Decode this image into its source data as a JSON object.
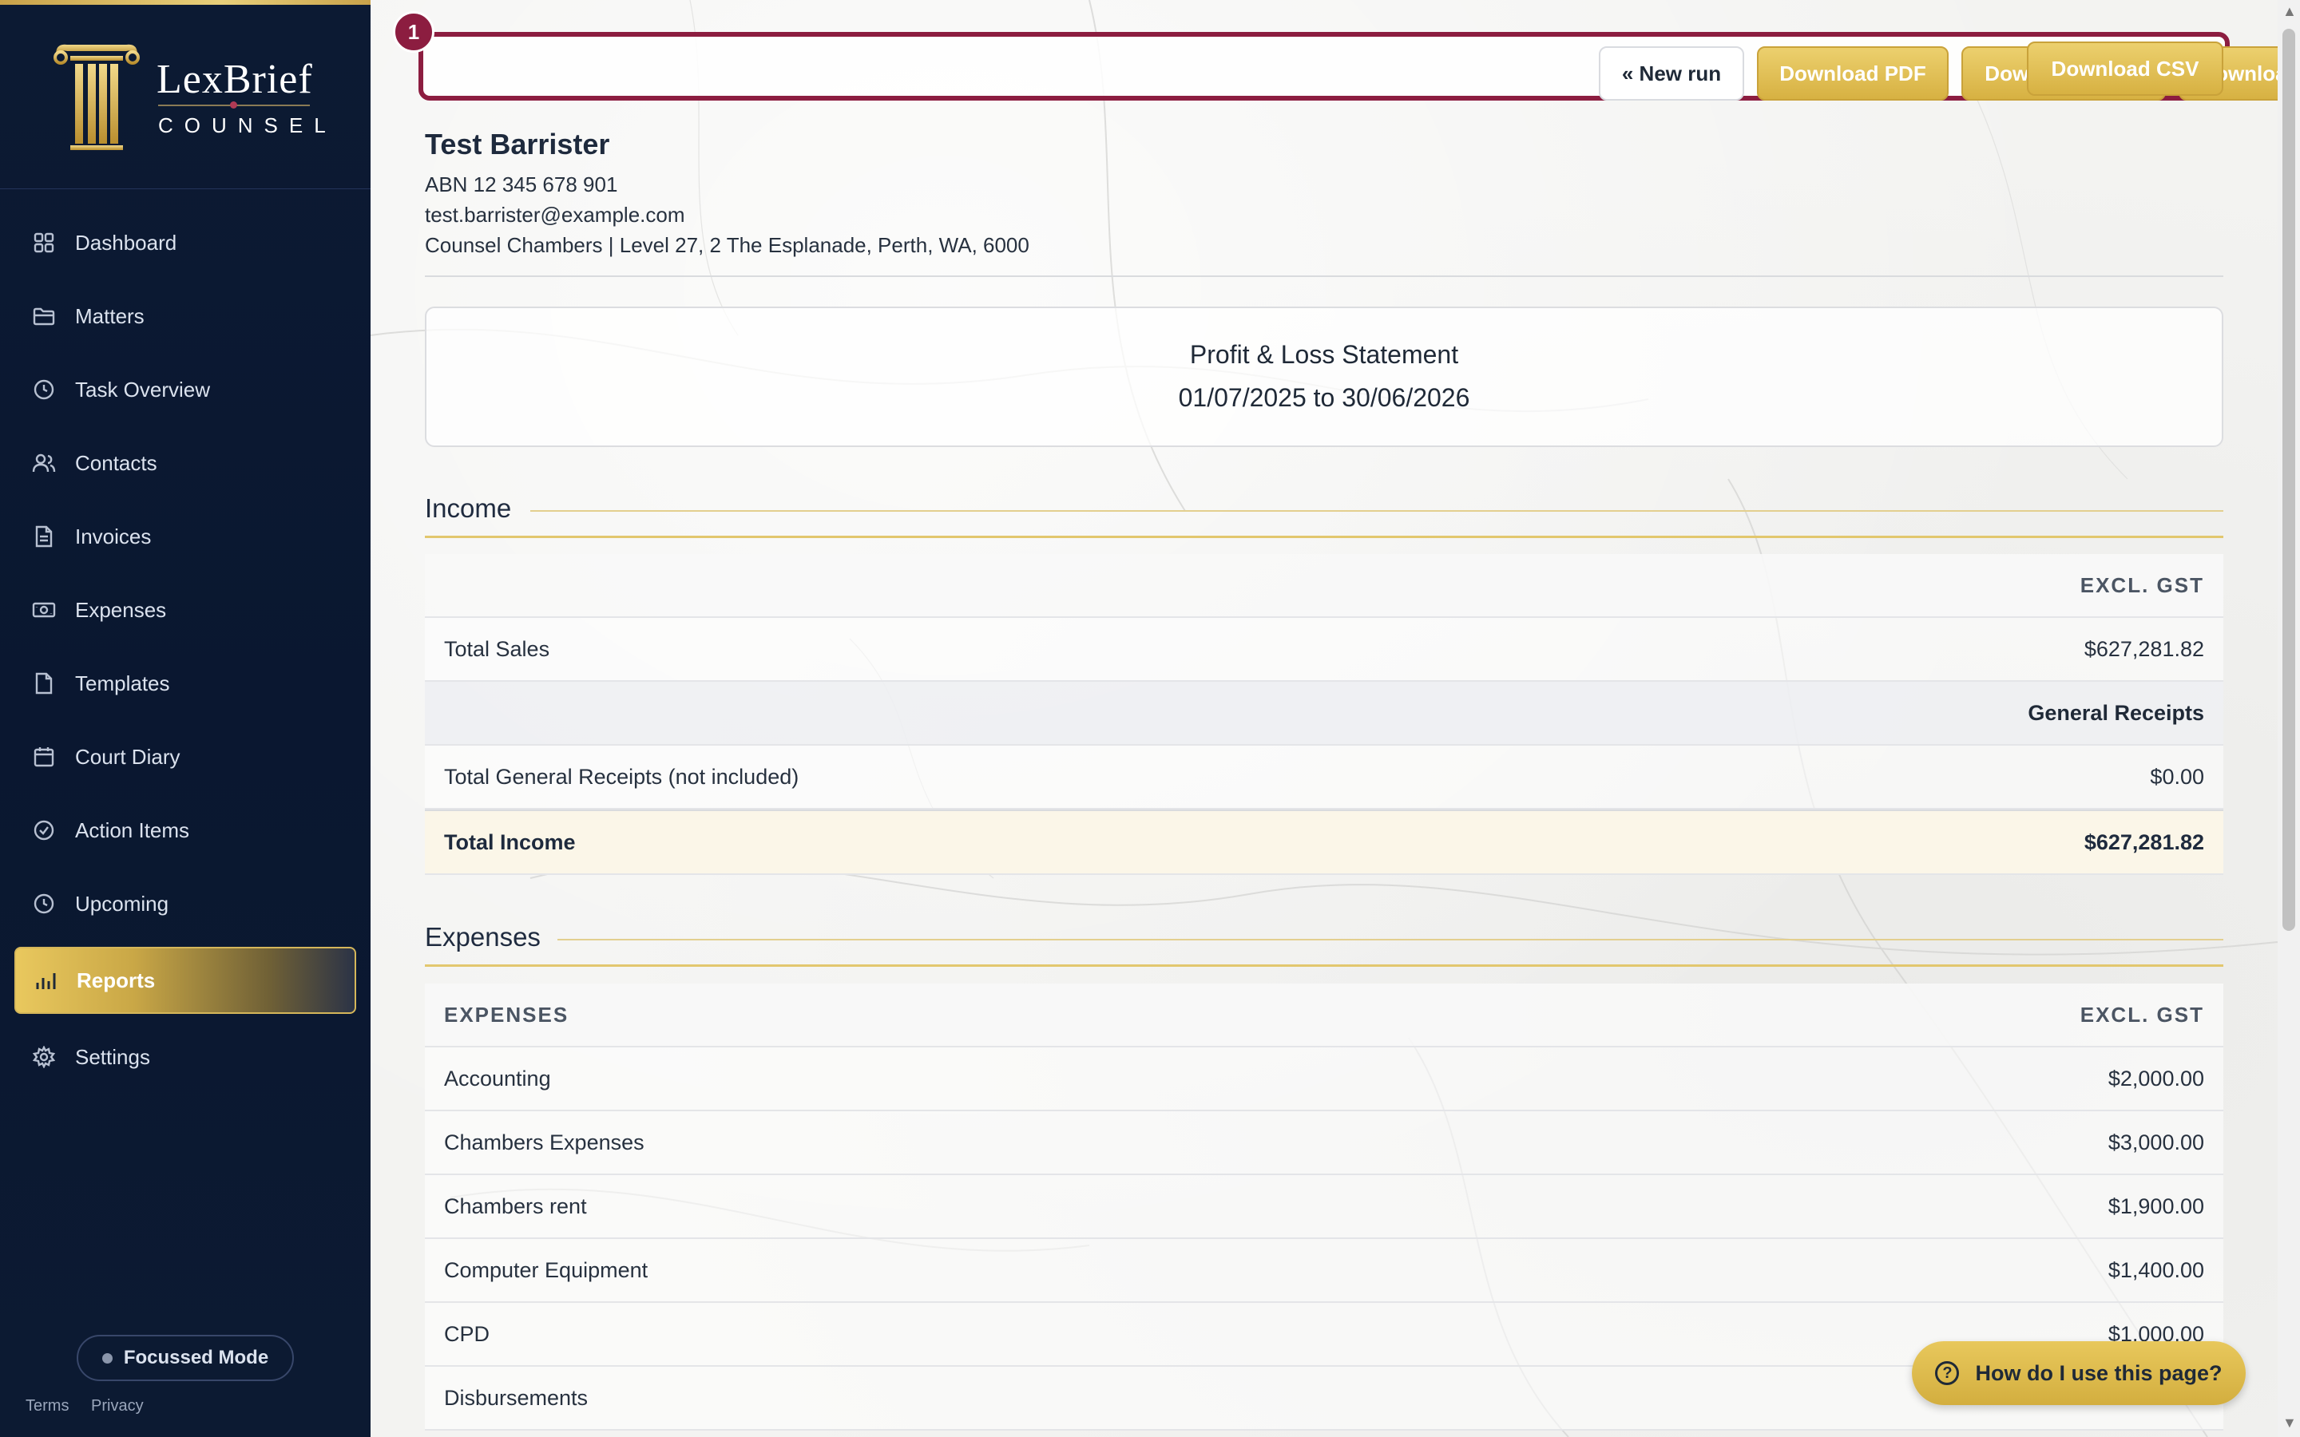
{
  "brand": {
    "name": "LexBrief",
    "tagline": "COUNSEL"
  },
  "colors": {
    "navy": "#0c1a33",
    "gold": "#d7b142",
    "maroon": "#8c1d40"
  },
  "sidebar": {
    "items": [
      {
        "label": "Dashboard",
        "icon": "grid-icon"
      },
      {
        "label": "Matters",
        "icon": "folder-icon"
      },
      {
        "label": "Task Overview",
        "icon": "clock-icon"
      },
      {
        "label": "Contacts",
        "icon": "users-icon"
      },
      {
        "label": "Invoices",
        "icon": "document-icon"
      },
      {
        "label": "Expenses",
        "icon": "banknote-icon"
      },
      {
        "label": "Templates",
        "icon": "file-icon"
      },
      {
        "label": "Court Diary",
        "icon": "calendar-icon"
      },
      {
        "label": "Action Items",
        "icon": "check-circle-icon"
      },
      {
        "label": "Upcoming",
        "icon": "clock-icon"
      },
      {
        "label": "Reports",
        "icon": "bar-chart-icon",
        "active": true
      },
      {
        "label": "Settings",
        "icon": "gear-icon"
      }
    ],
    "focus_mode": "Focussed Mode",
    "terms": "Terms",
    "privacy": "Privacy"
  },
  "toolbar": {
    "step": "1",
    "new_run": "« New run",
    "pdf": "Download PDF",
    "word": "Download Word",
    "excel": "Download Excel",
    "csv": "Download CSV"
  },
  "firm": {
    "name": "Test Barrister",
    "abn": "ABN 12 345 678 901",
    "email": "test.barrister@example.com",
    "address": "Counsel Chambers | Level 27, 2 The Esplanade, Perth, WA, 6000"
  },
  "report": {
    "title": "Profit & Loss Statement",
    "period": "01/07/2025 to 30/06/2026"
  },
  "income": {
    "heading": "Income",
    "col_header": "EXCL. GST",
    "total_sales_label": "Total Sales",
    "total_sales_value": "$627,281.82",
    "general_receipts_label": "General Receipts",
    "general_receipts_total_label": "Total General Receipts (not included)",
    "general_receipts_total_value": "$0.00",
    "total_income_label": "Total Income",
    "total_income_value": "$627,281.82"
  },
  "expenses": {
    "heading": "Expenses",
    "col_left": "EXPENSES",
    "col_right": "EXCL. GST",
    "rows": [
      {
        "label": "Accounting",
        "value": "$2,000.00"
      },
      {
        "label": "Chambers Expenses",
        "value": "$3,000.00"
      },
      {
        "label": "Chambers rent",
        "value": "$1,900.00"
      },
      {
        "label": "Computer Equipment",
        "value": "$1,400.00"
      },
      {
        "label": "CPD",
        "value": "$1,000.00"
      },
      {
        "label": "Disbursements",
        "value": ""
      }
    ]
  },
  "help": {
    "label": "How do I use this page?"
  }
}
